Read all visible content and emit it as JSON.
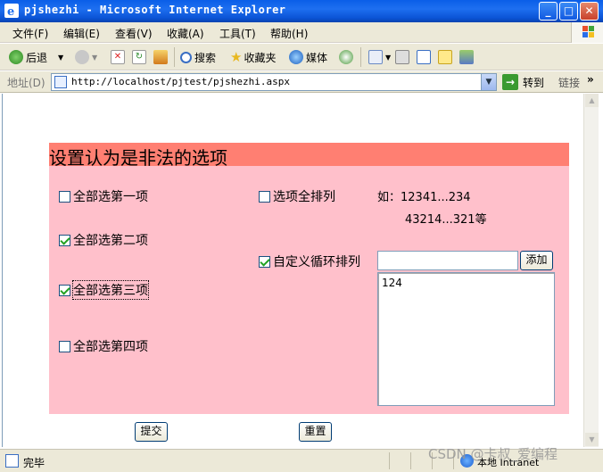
{
  "window": {
    "title": "pjshezhi - Microsoft Internet Explorer",
    "minimize": "_",
    "maximize": "□",
    "close": "✕"
  },
  "menu": [
    "文件(F)",
    "编辑(E)",
    "查看(V)",
    "收藏(A)",
    "工具(T)",
    "帮助(H)"
  ],
  "toolbar": {
    "back": "后退",
    "search": "搜索",
    "favorites": "收藏夹",
    "media": "媒体"
  },
  "address": {
    "label": "地址(D)",
    "url": "http://localhost/pjtest/pjshezhi.aspx",
    "go": "转到",
    "links": "链接",
    "more": "»"
  },
  "page": {
    "heading": "设置认为是非法的选项",
    "options": [
      {
        "label": "全部选第一项",
        "checked": false
      },
      {
        "label": "全部选第二项",
        "checked": true
      },
      {
        "label": "全部选第三项",
        "checked": true
      },
      {
        "label": "全部选第四项",
        "checked": false
      }
    ],
    "permutation": {
      "label": "选项全排列",
      "checked": false
    },
    "example_line1": "如：12341...234",
    "example_line2": "43214...321等",
    "custom_cycle": {
      "label": "自定义循环排列",
      "checked": true
    },
    "custom_input_value": "",
    "add_button": "添加",
    "list_items": [
      "124"
    ],
    "submit_button": "提交",
    "reset_button": "重置"
  },
  "status": {
    "text": "完毕",
    "zone": "本地 Intranet"
  },
  "watermark": "CSDN @卡叔_爱编程"
}
